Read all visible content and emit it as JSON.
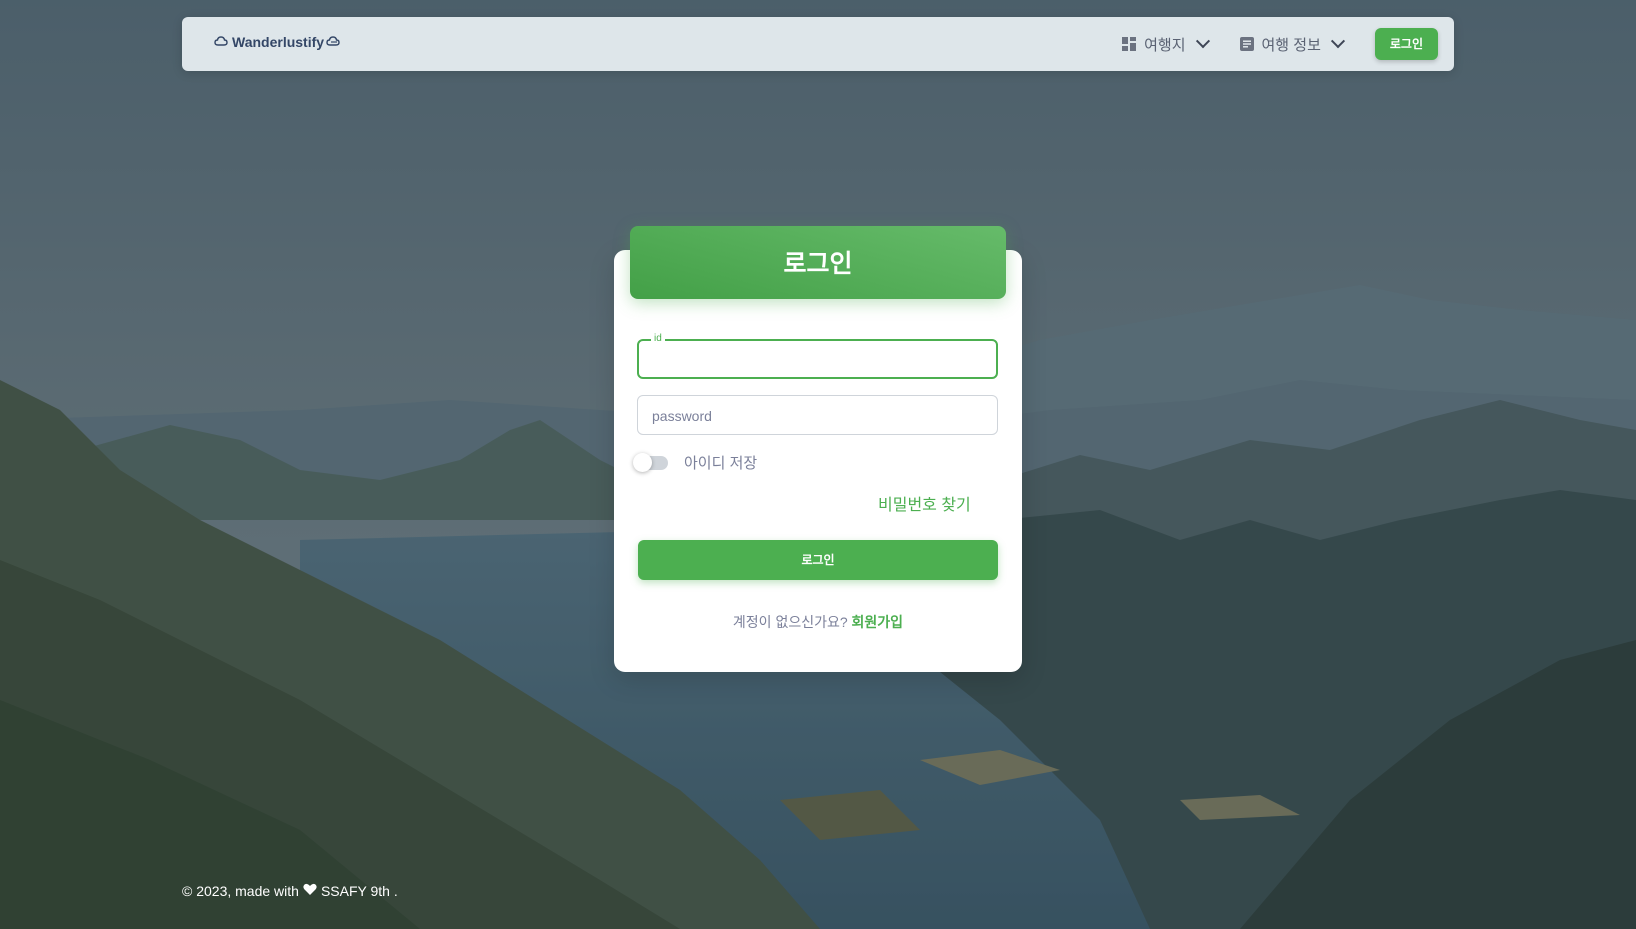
{
  "navbar": {
    "brand": "Wanderlustify",
    "menu": [
      {
        "label": "여행지",
        "icon": "dashboard-icon"
      },
      {
        "label": "여행 정보",
        "icon": "article-icon"
      }
    ],
    "login_label": "로그인"
  },
  "card": {
    "title": "로그인",
    "id_label": "id",
    "id_value": "",
    "password_placeholder": "password",
    "remember_label": "아이디 저장",
    "remember_checked": false,
    "find_password": "비밀번호 찾기",
    "submit_label": "로그인",
    "no_account_text": "계정이 없으신가요?",
    "signup_link": "회원가입"
  },
  "footer": {
    "prefix": "© 2023, made with",
    "suffix": "SSAFY 9th ."
  },
  "colors": {
    "accent": "#4caf50",
    "text_dark": "#344767",
    "text_muted": "#7b809a"
  }
}
